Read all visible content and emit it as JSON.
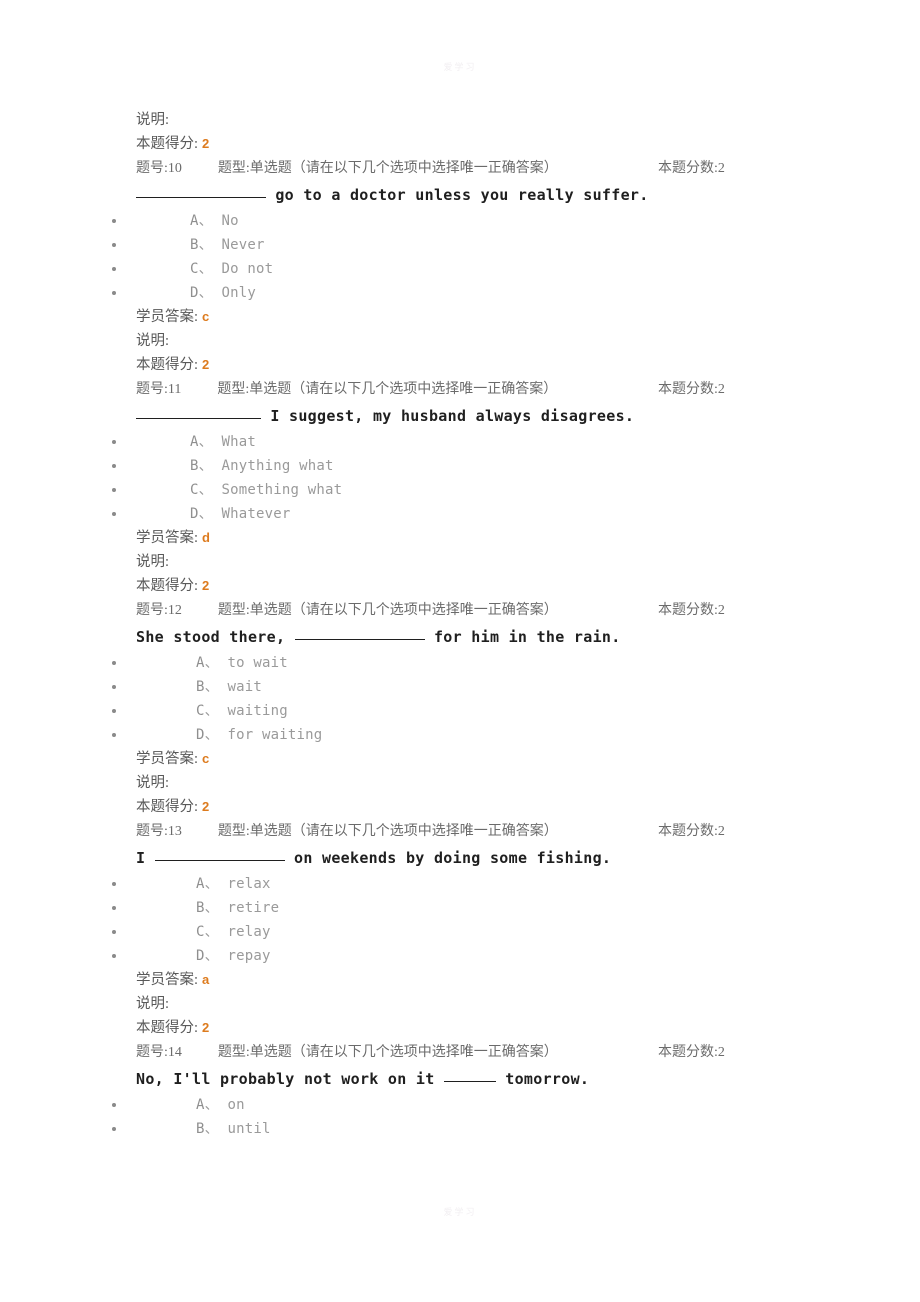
{
  "page": {
    "watermark_top": "爱学习",
    "watermark_bottom": "爱学习"
  },
  "labels": {
    "explanation": "说明:",
    "score_earned": "本题得分:",
    "student_answer": "学员答案:",
    "question_no_prefix": "题号:",
    "question_type_prefix": "题型:",
    "question_points_prefix": "本题分数:",
    "option_sep": "、"
  },
  "colors": {
    "answer_orange": "#dd7b1e",
    "label_gray": "#595959",
    "option_gray": "#9a9a9a",
    "stem_black": "#1f1f1f",
    "page_background": "#ffffff"
  },
  "lead_in": {
    "explanation": "说明:",
    "score_label": "本题得分:",
    "score_value": "2"
  },
  "questions": [
    {
      "number": "10",
      "number_line": "题号:10",
      "type_line": "题型:单选题（请在以下几个选项中选择唯一正确答案）",
      "points_line": "本题分数:2",
      "stem_before": "",
      "blank": "long",
      "stem_after": " go to a doctor unless you really suffer.",
      "options": [
        {
          "letter": "A",
          "text": "No"
        },
        {
          "letter": "B",
          "text": "Never"
        },
        {
          "letter": "C",
          "text": "Do not"
        },
        {
          "letter": "D",
          "text": "Only"
        }
      ],
      "student_answer_label": "学员答案:",
      "student_answer": "c",
      "explanation_label": "说明:",
      "explanation_text": "",
      "score_label": "本题得分:",
      "score_value": "2"
    },
    {
      "number": "11",
      "number_line": "题号:11",
      "type_line": "题型:单选题（请在以下几个选项中选择唯一正确答案）",
      "points_line": "本题分数:2",
      "stem_before": "",
      "blank": "mid",
      "stem_after": " I suggest, my husband always disagrees.",
      "options": [
        {
          "letter": "A",
          "text": "What"
        },
        {
          "letter": "B",
          "text": "Anything what"
        },
        {
          "letter": "C",
          "text": "Something what"
        },
        {
          "letter": "D",
          "text": "Whatever"
        }
      ],
      "student_answer_label": "学员答案:",
      "student_answer": "d",
      "explanation_label": "说明:",
      "explanation_text": "",
      "score_label": "本题得分:",
      "score_value": "2"
    },
    {
      "number": "12",
      "number_line": "题号:12",
      "type_line": "题型:单选题（请在以下几个选项中选择唯一正确答案）",
      "points_line": "本题分数:2",
      "stem_before": "She stood there, ",
      "blank": "long",
      "stem_after": " for him in the rain.",
      "options": [
        {
          "letter": "A",
          "text": "to wait"
        },
        {
          "letter": "B",
          "text": "wait"
        },
        {
          "letter": "C",
          "text": "waiting"
        },
        {
          "letter": "D",
          "text": "for waiting"
        }
      ],
      "student_answer_label": "学员答案:",
      "student_answer": "c",
      "explanation_label": "说明:",
      "explanation_text": "",
      "score_label": "本题得分:",
      "score_value": "2"
    },
    {
      "number": "13",
      "number_line": "题号:13",
      "type_line": "题型:单选题（请在以下几个选项中选择唯一正确答案）",
      "points_line": "本题分数:2",
      "stem_before": "I ",
      "blank": "long",
      "stem_after": " on weekends by doing some fishing.",
      "options": [
        {
          "letter": "A",
          "text": "relax"
        },
        {
          "letter": "B",
          "text": "retire"
        },
        {
          "letter": "C",
          "text": "relay"
        },
        {
          "letter": "D",
          "text": "repay"
        }
      ],
      "student_answer_label": "学员答案:",
      "student_answer": "a",
      "explanation_label": "说明:",
      "explanation_text": "",
      "score_label": "本题得分:",
      "score_value": "2"
    },
    {
      "number": "14",
      "number_line": "题号:14",
      "type_line": "题型:单选题（请在以下几个选项中选择唯一正确答案）",
      "points_line": "本题分数:2",
      "stem_before": "No, I'll probably not work on it ",
      "blank": "short",
      "stem_after": " tomorrow.",
      "options": [
        {
          "letter": "A",
          "text": "on"
        },
        {
          "letter": "B",
          "text": "until"
        }
      ],
      "student_answer_label": "",
      "student_answer": "",
      "explanation_label": "",
      "explanation_text": "",
      "score_label": "",
      "score_value": ""
    }
  ]
}
